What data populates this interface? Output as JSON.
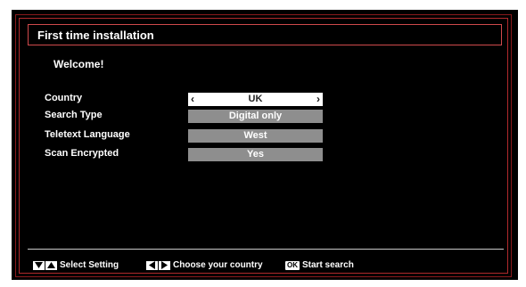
{
  "title": "First time installation",
  "welcome": "Welcome!",
  "settings": [
    {
      "label": "Country",
      "value": "UK"
    },
    {
      "label": "Search Type",
      "value": "Digital only"
    },
    {
      "label": "Teletext Language",
      "value": "West"
    },
    {
      "label": "Scan Encrypted",
      "value": "Yes"
    }
  ],
  "footer": {
    "select_setting": "Select Setting",
    "choose_country": "Choose your country",
    "ok_key": "OK",
    "start_search": "Start search"
  },
  "colors": {
    "frame": "#b02a2c",
    "selected_bg": "#ffffff",
    "option_bg": "#8e8e8e"
  }
}
